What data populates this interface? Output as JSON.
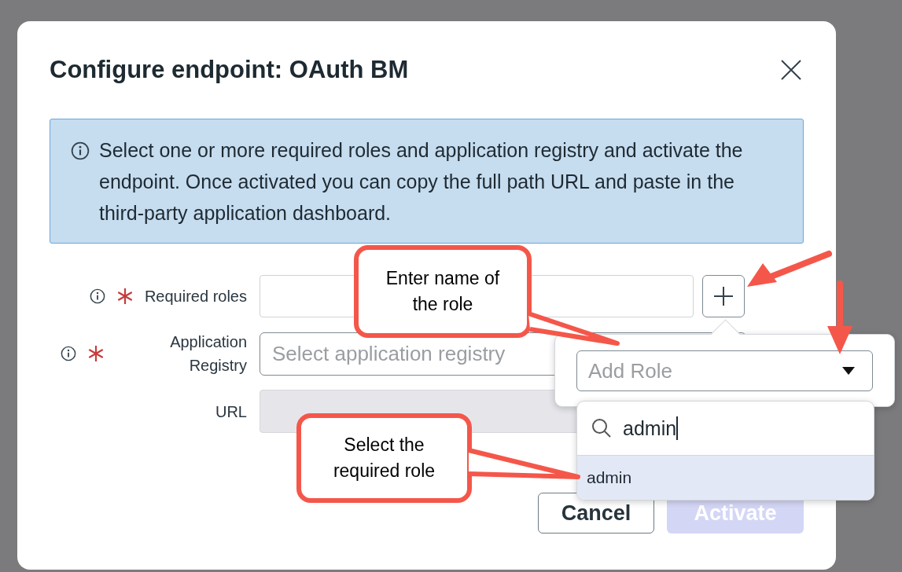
{
  "dialog": {
    "title": "Configure endpoint: OAuth BM"
  },
  "info": "Select one or more required roles and application registry and activate the endpoint. Once activated you can copy the full path URL and paste in the third-party application dashboard.",
  "fields": [
    {
      "kind": "text",
      "label": "Required roles",
      "required": true,
      "info": true
    },
    {
      "kind": "select",
      "label": "Application Registry",
      "required": true,
      "info": true,
      "placeholder": "Select application registry"
    },
    {
      "kind": "readonly",
      "label": "URL",
      "required": false,
      "info": false
    }
  ],
  "role_popover": {
    "placeholder": "Add Role",
    "search_value": "admin",
    "options": [
      {
        "label": "admin",
        "selected": true
      }
    ]
  },
  "buttons": [
    {
      "label": "Cancel",
      "disabled": false
    },
    {
      "label": "Activate",
      "disabled": true
    }
  ],
  "callouts": [
    {
      "text": "Enter name of the role"
    },
    {
      "text": "Select the required role"
    }
  ]
}
